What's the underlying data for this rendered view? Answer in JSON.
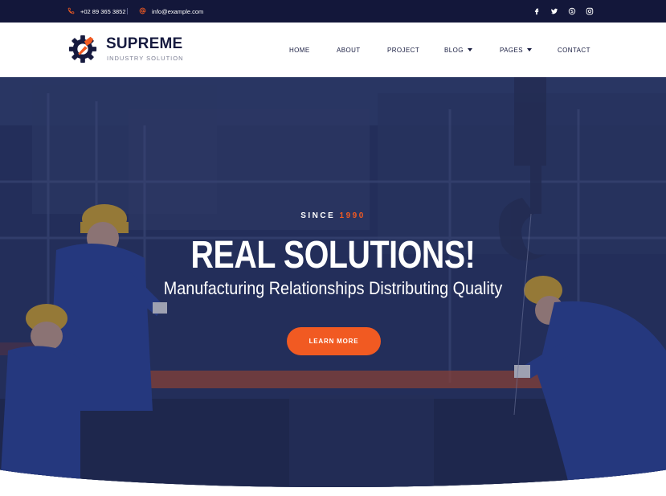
{
  "topbar": {
    "phone": "+02 89 365 3852",
    "phone_icon": "phone-icon",
    "email": "info@example.com",
    "email_icon": "at-icon",
    "socials": [
      "facebook-icon",
      "twitter-icon",
      "skype-icon",
      "instagram-icon"
    ]
  },
  "brand": {
    "name": "SUPREME",
    "tagline": "INDUSTRY SOLUTION",
    "logo_icon": "gear-wrench-icon"
  },
  "nav": {
    "home": "HOME",
    "about": "ABOUT",
    "project": "PROJECT",
    "blog": "BLOG",
    "pages": "PAGES",
    "contact": "CONTACT"
  },
  "hero": {
    "since_label": "SINCE",
    "since_year": "1990",
    "headline": "REAL SOLUTIONS!",
    "subline": "Manufacturing Relationships Distributing Quality",
    "cta_label": "LEARN MORE"
  },
  "colors": {
    "accent": "#f15a22",
    "navy": "#13173a",
    "brand_text": "#161a3f"
  }
}
